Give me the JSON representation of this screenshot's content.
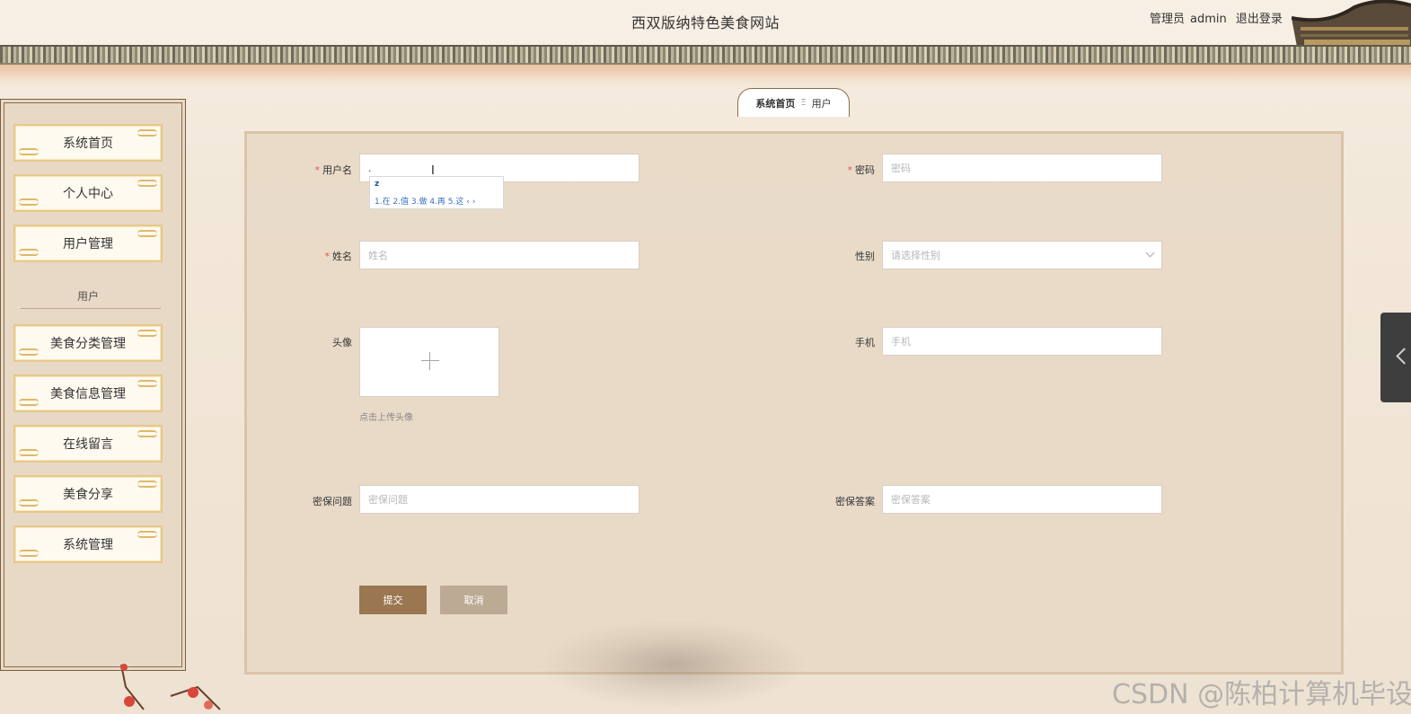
{
  "header": {
    "site_title": "西双版纳特色美食网站",
    "role_label": "管理员",
    "username": "admin",
    "logout_label": "退出登录"
  },
  "sidebar": {
    "items": [
      {
        "label": "系统首页"
      },
      {
        "label": "个人中心"
      },
      {
        "label": "用户管理"
      },
      {
        "label": "美食分类管理"
      },
      {
        "label": "美食信息管理"
      },
      {
        "label": "在线留言"
      },
      {
        "label": "美食分享"
      },
      {
        "label": "系统管理"
      }
    ],
    "group_label": "用户"
  },
  "breadcrumb": {
    "home": "系统首页",
    "separator_glyph": "Ξ",
    "current": "用户"
  },
  "form": {
    "required_mark": "*",
    "username": {
      "label": "用户名",
      "value": "."
    },
    "password": {
      "label": "密码",
      "placeholder": "密码"
    },
    "name": {
      "label": "姓名",
      "placeholder": "姓名"
    },
    "gender": {
      "label": "性别",
      "placeholder": "请选择性别"
    },
    "avatar": {
      "label": "头像",
      "tip": "点击上传头像"
    },
    "phone": {
      "label": "手机",
      "placeholder": "手机"
    },
    "security_question": {
      "label": "密保问题",
      "placeholder": "密保问题"
    },
    "security_answer": {
      "label": "密保答案",
      "placeholder": "密保答案"
    },
    "submit_label": "提交",
    "cancel_label": "取消"
  },
  "ime_popup": {
    "code": "z",
    "candidates": "1.在 2.值 3.做 4.再 5.这",
    "pager": "‹ ›"
  },
  "watermark": "CSDN @陈柏计算机毕设",
  "colors": {
    "submit": "#9a7651",
    "cancel": "#bdaa95",
    "required": "#e05a4e",
    "menu_border": "#e6c98a"
  }
}
